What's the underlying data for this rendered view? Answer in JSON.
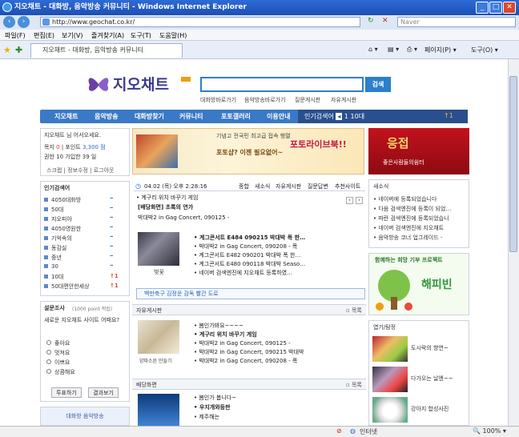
{
  "window": {
    "title": "지오채트 - 대화방, 음악방송 커뮤니티 - Windows Internet Explorer"
  },
  "address": {
    "url": "http://www.geochat.co.kr/",
    "search_placeholder": "Naver"
  },
  "menu": [
    "파일(F)",
    "편집(E)",
    "보기(V)",
    "즐겨찾기(A)",
    "도구(T)",
    "도움말(H)"
  ],
  "tab": {
    "title": "지오채트 - 대화방, 음악방송 커뮤니티"
  },
  "toolbar": {
    "page": "페이지(P)",
    "tools": "도구(O)"
  },
  "site": {
    "logo": "지오채트",
    "search_button": "검색",
    "top_links": [
      "대화방바로가기",
      "음악방송바로가기",
      "질문게시판",
      "자유게시판"
    ],
    "nav": [
      "지오채트",
      "음악방송",
      "대화방찾기",
      "커뮤니티",
      "포토갤러리",
      "이용안내"
    ],
    "ranking_label": "인기검색어",
    "ranking_value": "1 10대",
    "ranking_up": "1"
  },
  "login": {
    "greeting": "지오채트 님 어서오세요.",
    "money_label": "목지",
    "money_value": "0",
    "point_label": "포인트",
    "point_value": "3,300 점",
    "rank_label": "권한",
    "rank_value": "10 가입한 39 일",
    "links": [
      "스크랩",
      "정보수정",
      "로그아웃"
    ]
  },
  "popular": {
    "title": "인기검색어",
    "items": [
      {
        "text": "4050대화방",
        "mark": "–"
      },
      {
        "text": "50대",
        "mark": "–"
      },
      {
        "text": "지오피아",
        "mark": "–"
      },
      {
        "text": "4050영원한",
        "mark": "–"
      },
      {
        "text": "기억속의",
        "mark": "–"
      },
      {
        "text": "동감실",
        "mark": "–"
      },
      {
        "text": "중년",
        "mark": "–"
      },
      {
        "text": "30",
        "mark": "–"
      },
      {
        "text": "10대",
        "mark": "1"
      },
      {
        "text": "50대편안한세상",
        "mark": "1"
      }
    ]
  },
  "poll": {
    "title": "설문조사",
    "note": "(1000 point 적립)",
    "question": "새로운 지오채트 사이트 어때요?",
    "options": [
      "좋아요",
      "멋져요",
      "이쁘요",
      "상콤해요"
    ],
    "vote": "투표하기",
    "result": "결과보기",
    "banner": "대화방 음악방송"
  },
  "banner1": {
    "line1": "기념고 전국민 최고급 접속 행렬",
    "line2": "포토라이브북!!",
    "line3": "포토샵? 이젠 필요없어~"
  },
  "banner2": {
    "title": "응접",
    "subtitle": "좋은사람들의쉼터"
  },
  "date": {
    "text": "04.02 (목) 오후 2:28:16"
  },
  "board_tabs": [
    "종합",
    "새소식",
    "자유게시판",
    "질문답변",
    "추천사이트"
  ],
  "headline": {
    "top": "계구리 위치 바꾸기 게임",
    "item1": "[배당화면] 초록의 연가",
    "item2": "박대박2 in Gag Concert, 090125 -"
  },
  "news": {
    "caption": "벚꽃",
    "items": [
      "계그콘서트 E484 090215 박대박 폭 한…",
      "박대박2 in Gag Concert, 090208 - 폭",
      "계그콘서트 E482 090201 박대박 폭 한…",
      "계그콘서트 E480 090118 박대박 Seaso…",
      "네이버 검색엔진에 지오채트 등록하였…"
    ]
  },
  "notice_bar": "백만축구 김정운 감독 빨간 도로",
  "free_board": {
    "title": "자유게시판",
    "more": "목록",
    "caption": "양파소른 만들기",
    "items": [
      "봄인가봐요~~~~",
      "계구리 위치 바꾸기 게임",
      "박대박2 in Gag Concert, 090125 -",
      "박대박2 in Gag Concert, 090215 박대박",
      "박대박2 in Gag Concert, 090208 - 폭"
    ]
  },
  "wall_board": {
    "title": "배당화면",
    "more": "목록",
    "items": [
      "봄인가 봅니다~",
      "우지개와등판",
      "제주해는"
    ]
  },
  "news_right": {
    "title": "새소식",
    "items": [
      "네이버에 등록되었습니다",
      "다음 검색엔진에 등록이 되었…",
      "파란 검색엔진에 등록되었습니",
      "네이버 검색엔진에 지오채트",
      "음악방송 코너 업그레이드 -"
    ]
  },
  "happy": {
    "title": "함께하는 희망 기부 프로젝트",
    "brand": "해피빈"
  },
  "photo": {
    "title": "엽기/탐정",
    "more": "목록",
    "items": [
      "도시락의 향연~",
      "다가오는 날엔~~",
      "강아지 합성사진"
    ]
  },
  "status": {
    "zone": "인터넷",
    "zoom": "100%"
  },
  "colors": {
    "accent": "#3a79c6",
    "title": "#2d6bd6"
  }
}
